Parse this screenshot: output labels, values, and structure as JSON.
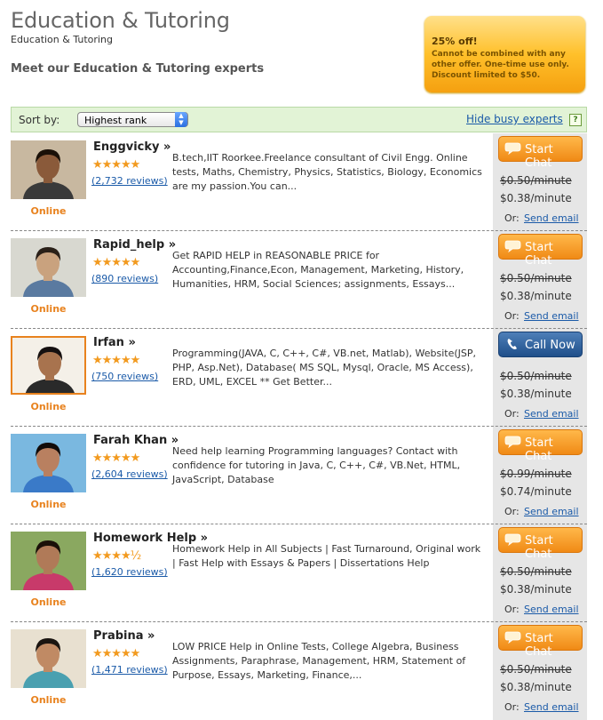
{
  "page": {
    "title": "Education & Tutoring",
    "breadcrumb": "Education & Tutoring",
    "subtitle": "Meet our Education & Tutoring experts"
  },
  "promo": {
    "title": "25% off!",
    "text": "Cannot be combined with any other offer. One-time use only. Discount limited to $50."
  },
  "sortbar": {
    "label": "Sort by:",
    "selected": "Highest rank",
    "hide_busy": "Hide busy experts",
    "help": "?"
  },
  "labels": {
    "or": "Or:",
    "send_email": "Send email"
  },
  "colors": {
    "accent_orange": "#e8821e",
    "link_blue": "#1a5aa8",
    "sort_bg": "#e2f3d6"
  },
  "experts": [
    {
      "name": "Enggvicky »",
      "rating": 5,
      "stars": "★★★★★",
      "reviews": "(2,732 reviews)",
      "status": "Online",
      "description": "B.tech,IIT Roorkee.Freelance consultant of Civil Engg. Online tests, Maths, Chemistry, Physics, Statistics, Biology, Economics are my passion.You can...",
      "action": "Start Chat",
      "action_icon": "chat-bubble-icon",
      "price_old": "$0.50/minute",
      "price_new": "$0.38/minute"
    },
    {
      "name": "Rapid_help »",
      "rating": 5,
      "stars": "★★★★★",
      "reviews": "(890 reviews)",
      "status": "Online",
      "description": "Get RAPID HELP in REASONABLE PRICE for Accounting,Finance,Econ, Management, Marketing, History, Humanities, HRM, Social Sciences; assignments, Essays...",
      "action": "Start Chat",
      "action_icon": "chat-bubble-icon",
      "price_old": "$0.50/minute",
      "price_new": "$0.38/minute"
    },
    {
      "name": "Irfan »",
      "rating": 5,
      "stars": "★★★★★",
      "reviews": "(750 reviews)",
      "status": "Online",
      "description": "Programming(JAVA, C, C++, C#, VB.net, Matlab), Website(JSP, PHP, Asp.Net), Database( MS SQL, Mysql, Oracle, MS Access), ERD, UML, EXCEL ** Get Better...",
      "action": "Call Now",
      "action_icon": "phone-icon",
      "price_old": "$0.50/minute",
      "price_new": "$0.38/minute"
    },
    {
      "name": "Farah Khan »",
      "rating": 5,
      "stars": "★★★★★",
      "reviews": "(2,604 reviews)",
      "status": "Online",
      "description": "Need help learning Programming languages? Contact with confidence for tutoring in Java, C, C++, C#, VB.Net, HTML, JavaScript, Database",
      "action": "Start Chat",
      "action_icon": "chat-bubble-icon",
      "price_old": "$0.99/minute",
      "price_new": "$0.74/minute"
    },
    {
      "name": "Homework Help »",
      "rating": 4.5,
      "stars": "★★★★½",
      "reviews": "(1,620 reviews)",
      "status": "Online",
      "description": "Homework Help in All Subjects | Fast Turnaround, Original work | Fast Help with Essays & Papers | Dissertations Help",
      "action": "Start Chat",
      "action_icon": "chat-bubble-icon",
      "price_old": "$0.50/minute",
      "price_new": "$0.38/minute"
    },
    {
      "name": "Prabina »",
      "rating": 5,
      "stars": "★★★★★",
      "reviews": "(1,471 reviews)",
      "status": "Online",
      "description": "LOW PRICE Help in Online Tests, College Algebra, Business Assignments, Paraphrase, Management, HRM, Statement of Purpose, Essays, Marketing, Finance,...",
      "action": "Start Chat",
      "action_icon": "chat-bubble-icon",
      "price_old": "$0.50/minute",
      "price_new": "$0.38/minute"
    }
  ]
}
